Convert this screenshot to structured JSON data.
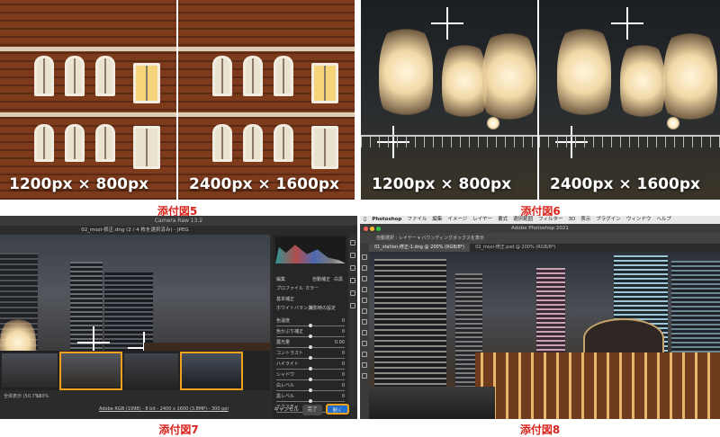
{
  "fig5": {
    "left_label": "1200px × 800px",
    "right_label": "2400px × 1600px",
    "caption": "添付図5"
  },
  "fig6": {
    "left_label": "1200px × 800px",
    "right_label": "2400px × 1600px",
    "caption": "添付図6"
  },
  "fig7": {
    "caption": "添付図7",
    "window_title": "Camera Raw 13.2",
    "file_name": "02_mozi-修正.dng (2 / 4 枚を選択済み) - JPEG",
    "panel": {
      "section_title": "編集",
      "auto_label": "自動補正",
      "bw_label": "白黒",
      "profile_label": "プロファイル",
      "profile_value": "カラー",
      "basic_label": "基本補正",
      "wb_label": "ホワイトバランス",
      "wb_value": "撮影時の設定",
      "sliders": [
        {
          "label": "色温度",
          "value": "0"
        },
        {
          "label": "色かぶり補正",
          "value": "0"
        },
        {
          "label": "露光量",
          "value": "0.00"
        },
        {
          "label": "コントラスト",
          "value": "0"
        },
        {
          "label": "ハイライト",
          "value": "0"
        },
        {
          "label": "シャドウ",
          "value": "0"
        },
        {
          "label": "白レベル",
          "value": "0"
        },
        {
          "label": "黒レベル",
          "value": "0"
        },
        {
          "label": "テクスチャ",
          "value": "0"
        }
      ]
    },
    "zoom_label": "全体表示 (50.7%)",
    "zoom_value": "100%",
    "info_link": "Adobe RGB (1998) - 8 bit - 2400 x 1600 (3.8MP) - 300 ppi",
    "cancel_label": "キャンセル",
    "done_label": "完了",
    "open_label": "開く",
    "accent_color": "#f2a11c"
  },
  "fig8": {
    "caption": "添付図8",
    "menu": [
      "Photoshop",
      "ファイル",
      "編集",
      "イメージ",
      "レイヤー",
      "書式",
      "選択範囲",
      "フィルター",
      "3D",
      "表示",
      "プラグイン",
      "ウィンドウ",
      "ヘルプ"
    ],
    "app_title": "Adobe Photoshop 2021",
    "options_text": "自動選択 : レイヤー ▾   バウンディングボックスを表示",
    "tabs": [
      "01_station-修正-1.dng @ 200% (RGB/8*)",
      "02_mozi-修正.psd @ 200% (RGB/8*)"
    ]
  },
  "colors": {
    "caption_red": "#d9241c"
  }
}
